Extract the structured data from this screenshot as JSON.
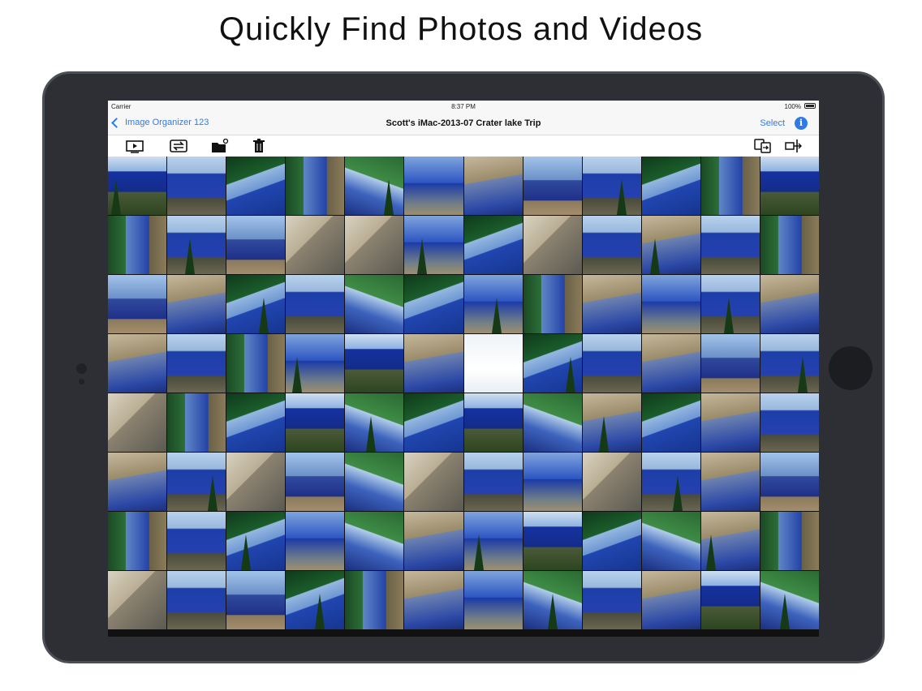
{
  "headline": "Quickly Find Photos and Videos",
  "status_bar": {
    "carrier": "Carrier",
    "time": "8:37 PM",
    "battery": "100%"
  },
  "nav_bar": {
    "back_label": "Image Organizer 123",
    "title": "Scott's iMac-2013-07 Crater lake Trip",
    "select_label": "Select",
    "info_icon": "info-icon"
  },
  "toolbar": {
    "left_icons": [
      "slideshow-icon",
      "repeat-icon",
      "new-folder-icon",
      "trash-icon"
    ],
    "right_icons": [
      "copy-to-icon",
      "move-to-icon"
    ]
  },
  "colors": {
    "accent": "#2f7ae5",
    "device_bezel": "#2d2f34",
    "device_border": "#4a4e55",
    "home_button": "#1c1d20"
  },
  "grid": {
    "rows": 8,
    "columns": 12,
    "photo_tiles": [
      [
        4,
        0,
        1,
        3,
        7,
        6,
        9,
        2,
        0,
        1,
        3,
        4
      ],
      [
        3,
        0,
        2,
        5,
        5,
        6,
        1,
        5,
        0,
        9,
        0,
        3
      ],
      [
        2,
        9,
        1,
        0,
        7,
        1,
        6,
        3,
        9,
        6,
        0,
        9
      ],
      [
        9,
        0,
        3,
        6,
        4,
        9,
        8,
        1,
        0,
        9,
        2,
        0
      ],
      [
        5,
        3,
        1,
        4,
        7,
        1,
        4,
        7,
        9,
        1,
        9,
        0
      ],
      [
        9,
        0,
        5,
        2,
        7,
        5,
        0,
        6,
        5,
        0,
        9,
        2
      ],
      [
        3,
        0,
        1,
        6,
        7,
        9,
        6,
        4,
        1,
        7,
        9,
        3
      ],
      [
        5,
        0,
        2,
        1,
        3,
        9,
        6,
        7,
        0,
        9,
        4,
        7
      ]
    ]
  }
}
